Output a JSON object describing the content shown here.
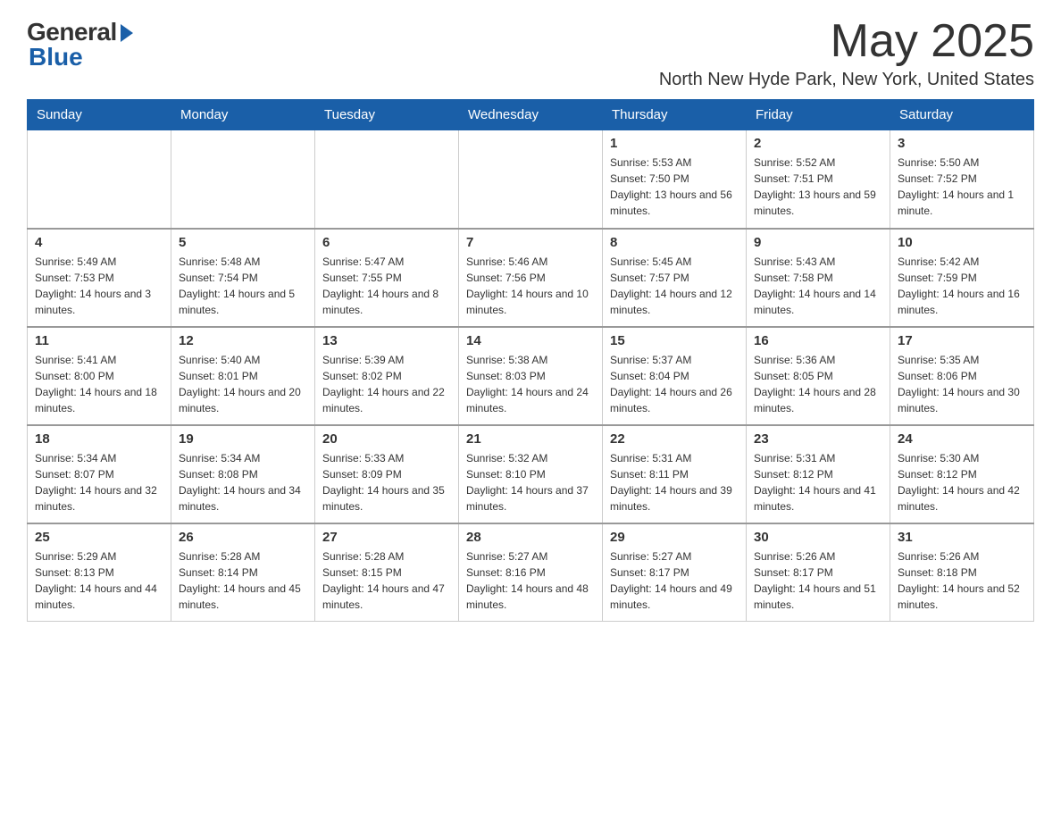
{
  "logo": {
    "general": "General",
    "blue": "Blue"
  },
  "title": "May 2025",
  "location": "North New Hyde Park, New York, United States",
  "days_of_week": [
    "Sunday",
    "Monday",
    "Tuesday",
    "Wednesday",
    "Thursday",
    "Friday",
    "Saturday"
  ],
  "weeks": [
    [
      {
        "day": "",
        "info": ""
      },
      {
        "day": "",
        "info": ""
      },
      {
        "day": "",
        "info": ""
      },
      {
        "day": "",
        "info": ""
      },
      {
        "day": "1",
        "info": "Sunrise: 5:53 AM\nSunset: 7:50 PM\nDaylight: 13 hours and 56 minutes."
      },
      {
        "day": "2",
        "info": "Sunrise: 5:52 AM\nSunset: 7:51 PM\nDaylight: 13 hours and 59 minutes."
      },
      {
        "day": "3",
        "info": "Sunrise: 5:50 AM\nSunset: 7:52 PM\nDaylight: 14 hours and 1 minute."
      }
    ],
    [
      {
        "day": "4",
        "info": "Sunrise: 5:49 AM\nSunset: 7:53 PM\nDaylight: 14 hours and 3 minutes."
      },
      {
        "day": "5",
        "info": "Sunrise: 5:48 AM\nSunset: 7:54 PM\nDaylight: 14 hours and 5 minutes."
      },
      {
        "day": "6",
        "info": "Sunrise: 5:47 AM\nSunset: 7:55 PM\nDaylight: 14 hours and 8 minutes."
      },
      {
        "day": "7",
        "info": "Sunrise: 5:46 AM\nSunset: 7:56 PM\nDaylight: 14 hours and 10 minutes."
      },
      {
        "day": "8",
        "info": "Sunrise: 5:45 AM\nSunset: 7:57 PM\nDaylight: 14 hours and 12 minutes."
      },
      {
        "day": "9",
        "info": "Sunrise: 5:43 AM\nSunset: 7:58 PM\nDaylight: 14 hours and 14 minutes."
      },
      {
        "day": "10",
        "info": "Sunrise: 5:42 AM\nSunset: 7:59 PM\nDaylight: 14 hours and 16 minutes."
      }
    ],
    [
      {
        "day": "11",
        "info": "Sunrise: 5:41 AM\nSunset: 8:00 PM\nDaylight: 14 hours and 18 minutes."
      },
      {
        "day": "12",
        "info": "Sunrise: 5:40 AM\nSunset: 8:01 PM\nDaylight: 14 hours and 20 minutes."
      },
      {
        "day": "13",
        "info": "Sunrise: 5:39 AM\nSunset: 8:02 PM\nDaylight: 14 hours and 22 minutes."
      },
      {
        "day": "14",
        "info": "Sunrise: 5:38 AM\nSunset: 8:03 PM\nDaylight: 14 hours and 24 minutes."
      },
      {
        "day": "15",
        "info": "Sunrise: 5:37 AM\nSunset: 8:04 PM\nDaylight: 14 hours and 26 minutes."
      },
      {
        "day": "16",
        "info": "Sunrise: 5:36 AM\nSunset: 8:05 PM\nDaylight: 14 hours and 28 minutes."
      },
      {
        "day": "17",
        "info": "Sunrise: 5:35 AM\nSunset: 8:06 PM\nDaylight: 14 hours and 30 minutes."
      }
    ],
    [
      {
        "day": "18",
        "info": "Sunrise: 5:34 AM\nSunset: 8:07 PM\nDaylight: 14 hours and 32 minutes."
      },
      {
        "day": "19",
        "info": "Sunrise: 5:34 AM\nSunset: 8:08 PM\nDaylight: 14 hours and 34 minutes."
      },
      {
        "day": "20",
        "info": "Sunrise: 5:33 AM\nSunset: 8:09 PM\nDaylight: 14 hours and 35 minutes."
      },
      {
        "day": "21",
        "info": "Sunrise: 5:32 AM\nSunset: 8:10 PM\nDaylight: 14 hours and 37 minutes."
      },
      {
        "day": "22",
        "info": "Sunrise: 5:31 AM\nSunset: 8:11 PM\nDaylight: 14 hours and 39 minutes."
      },
      {
        "day": "23",
        "info": "Sunrise: 5:31 AM\nSunset: 8:12 PM\nDaylight: 14 hours and 41 minutes."
      },
      {
        "day": "24",
        "info": "Sunrise: 5:30 AM\nSunset: 8:12 PM\nDaylight: 14 hours and 42 minutes."
      }
    ],
    [
      {
        "day": "25",
        "info": "Sunrise: 5:29 AM\nSunset: 8:13 PM\nDaylight: 14 hours and 44 minutes."
      },
      {
        "day": "26",
        "info": "Sunrise: 5:28 AM\nSunset: 8:14 PM\nDaylight: 14 hours and 45 minutes."
      },
      {
        "day": "27",
        "info": "Sunrise: 5:28 AM\nSunset: 8:15 PM\nDaylight: 14 hours and 47 minutes."
      },
      {
        "day": "28",
        "info": "Sunrise: 5:27 AM\nSunset: 8:16 PM\nDaylight: 14 hours and 48 minutes."
      },
      {
        "day": "29",
        "info": "Sunrise: 5:27 AM\nSunset: 8:17 PM\nDaylight: 14 hours and 49 minutes."
      },
      {
        "day": "30",
        "info": "Sunrise: 5:26 AM\nSunset: 8:17 PM\nDaylight: 14 hours and 51 minutes."
      },
      {
        "day": "31",
        "info": "Sunrise: 5:26 AM\nSunset: 8:18 PM\nDaylight: 14 hours and 52 minutes."
      }
    ]
  ]
}
